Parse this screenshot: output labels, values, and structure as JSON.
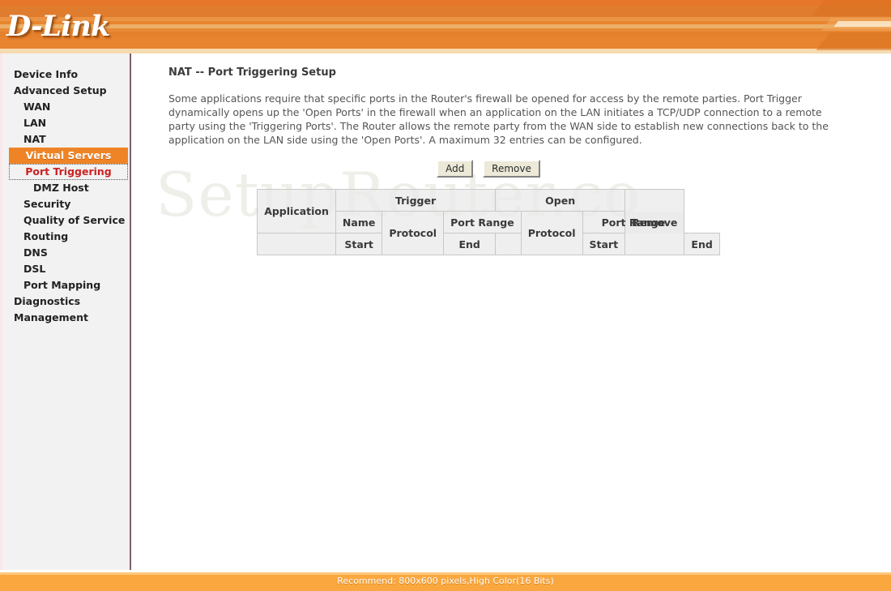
{
  "header": {
    "logo_text": "D-Link"
  },
  "sidebar": {
    "items": [
      {
        "label": "Device Info",
        "level": 1,
        "state": "normal"
      },
      {
        "label": "Advanced Setup",
        "level": 1,
        "state": "normal"
      },
      {
        "label": "WAN",
        "level": 2,
        "state": "normal"
      },
      {
        "label": "LAN",
        "level": 2,
        "state": "normal"
      },
      {
        "label": "NAT",
        "level": 2,
        "state": "normal"
      },
      {
        "label": "Virtual Servers",
        "level": 3,
        "state": "selected"
      },
      {
        "label": "Port Triggering",
        "level": 3,
        "state": "active"
      },
      {
        "label": "DMZ Host",
        "level": 3,
        "state": "normal"
      },
      {
        "label": "Security",
        "level": 2,
        "state": "normal"
      },
      {
        "label": "Quality of Service",
        "level": 2,
        "state": "normal"
      },
      {
        "label": "Routing",
        "level": 2,
        "state": "normal"
      },
      {
        "label": "DNS",
        "level": 2,
        "state": "normal"
      },
      {
        "label": "DSL",
        "level": 2,
        "state": "normal"
      },
      {
        "label": "Port Mapping",
        "level": 2,
        "state": "normal"
      },
      {
        "label": "Diagnostics",
        "level": 1,
        "state": "normal"
      },
      {
        "label": "Management",
        "level": 1,
        "state": "normal"
      }
    ]
  },
  "main": {
    "title": "NAT -- Port Triggering Setup",
    "description": "Some applications require that specific ports in the Router's firewall be opened for access by the remote parties. Port Trigger dynamically opens up the 'Open Ports' in the firewall when an application on the LAN initiates a TCP/UDP connection to a remote party using the 'Triggering Ports'. The Router allows the remote party from the WAN side to establish new connections back to the application on the LAN side using the 'Open Ports'. A maximum 32 entries can be configured.",
    "watermark": "SetupRouter.co",
    "buttons": {
      "add": "Add",
      "remove": "Remove"
    },
    "table": {
      "header_row_1": {
        "application": "Application",
        "trigger": "Trigger",
        "open": "Open",
        "remove": "Remove"
      },
      "header_row_2": {
        "name": "Name",
        "trigger_protocol": "Protocol",
        "trigger_port_range": "Port Range",
        "open_protocol": "Protocol",
        "open_port_range": "Port Range"
      },
      "header_row_3": {
        "trigger_start": "Start",
        "trigger_end": "End",
        "open_start": "Start",
        "open_end": "End"
      },
      "rows": []
    }
  },
  "footer": {
    "text": "Recommend: 800x600 pixels,High Color(16 Bits)"
  },
  "colors": {
    "brand_orange": "#e8792b",
    "selected_orange": "#ef8426",
    "active_red": "#cc2222",
    "footer_orange": "#f9a73e",
    "sidebar_bg": "#f2f2f2"
  }
}
